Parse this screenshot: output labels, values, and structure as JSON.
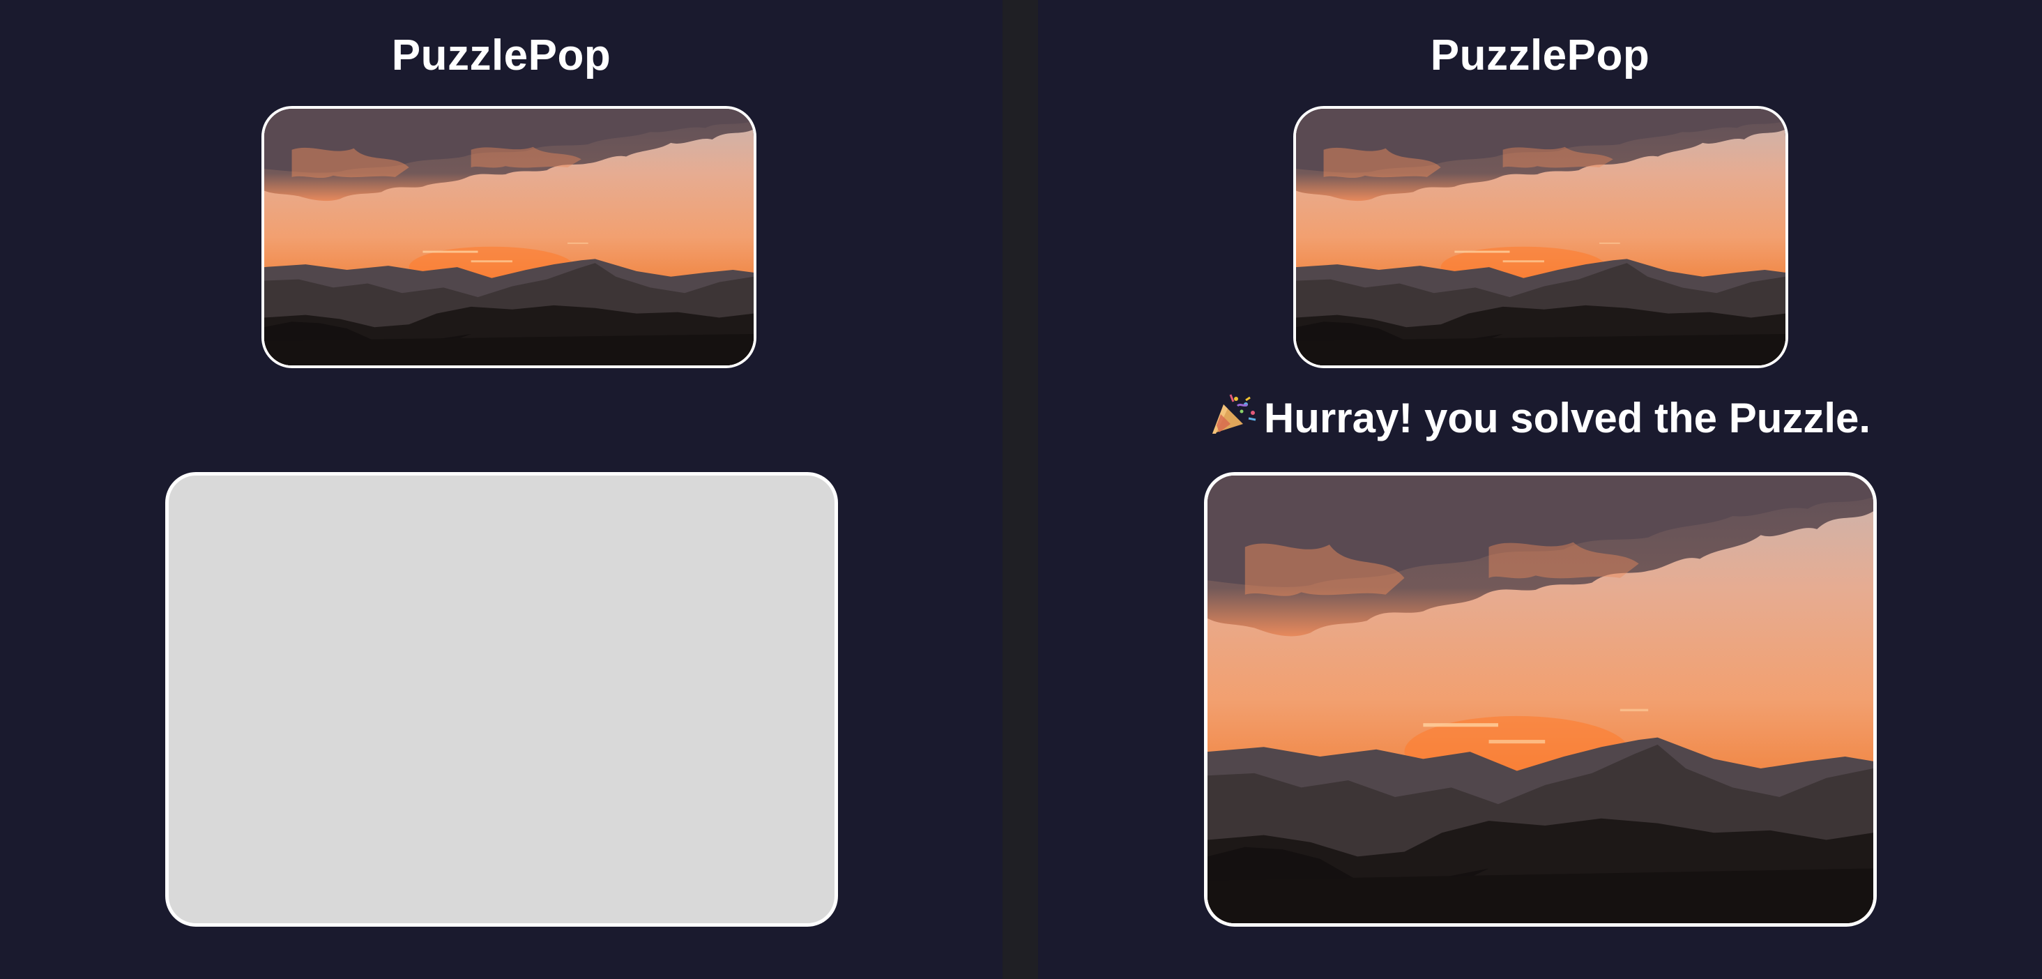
{
  "left_panel": {
    "title": "PuzzlePop",
    "reference_image": "sunset-mountains",
    "board": {
      "state": "empty",
      "color": "#d9d9d9"
    }
  },
  "right_panel": {
    "title": "PuzzlePop",
    "reference_image": "sunset-mountains",
    "success_icon": "party-popper-icon",
    "success_message": "Hurray! you solved the Puzzle.",
    "solved_image": "sunset-mountains"
  },
  "colors": {
    "background": "#1a1a2e",
    "divider": "#1f1f24",
    "frame_border": "#ffffff",
    "text": "#ffffff"
  }
}
